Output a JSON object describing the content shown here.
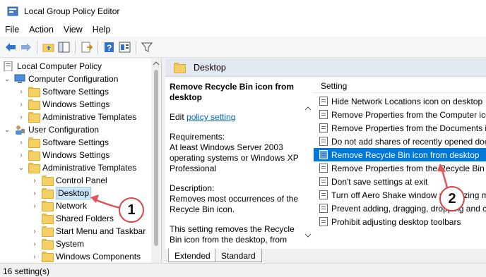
{
  "window": {
    "title": "Local Group Policy Editor"
  },
  "menu": [
    "File",
    "Action",
    "View",
    "Help"
  ],
  "toolbar_icons": [
    "back-arrow-icon",
    "forward-arrow-icon",
    "folder-up-icon",
    "show-hide-tree-icon",
    "export-list-icon",
    "help-icon",
    "extended-view-icon",
    "filter-icon"
  ],
  "tree": {
    "root": "Local Computer Policy",
    "computer_config": "Computer Configuration",
    "cc_children": [
      "Software Settings",
      "Windows Settings",
      "Administrative Templates"
    ],
    "user_config": "User Configuration",
    "uc_children": [
      "Software Settings",
      "Windows Settings",
      "Administrative Templates"
    ],
    "at_children": [
      "Control Panel",
      "Desktop",
      "Network",
      "Shared Folders",
      "Start Menu and Taskbar",
      "System",
      "Windows Components"
    ]
  },
  "right": {
    "header": "Desktop",
    "desc_title": "Remove Recycle Bin icon from desktop",
    "edit_prefix": "Edit",
    "edit_link": "policy setting",
    "requirements_label": "Requirements:",
    "requirements_text": "At least Windows Server 2003 operating systems or Windows XP Professional",
    "description_label": "Description:",
    "description_text": "Removes most occurrences of the Recycle Bin icon.",
    "description_more": "This setting removes the Recycle Bin icon from the desktop, from",
    "column_header": "Setting",
    "settings": [
      "Hide Network Locations icon on desktop",
      "Remove Properties from the Computer icon context menu",
      "Remove Properties from the Documents icon context menu",
      "Do not add shares of recently opened documents",
      "Remove Recycle Bin icon from desktop",
      "Remove Properties from the Recycle Bin context menu",
      "Don't save settings at exit",
      "Turn off Aero Shake window minimizing mouse gesture",
      "Prevent adding, dragging, dropping and closing",
      "Prohibit adjusting desktop toolbars"
    ]
  },
  "tabs": [
    "Extended",
    "Standard"
  ],
  "status": "16 setting(s)",
  "callouts": [
    "1",
    "2"
  ],
  "colors": {
    "selection": "#0078d7",
    "callout_border": "#d64545",
    "arrow": "#e05555"
  }
}
